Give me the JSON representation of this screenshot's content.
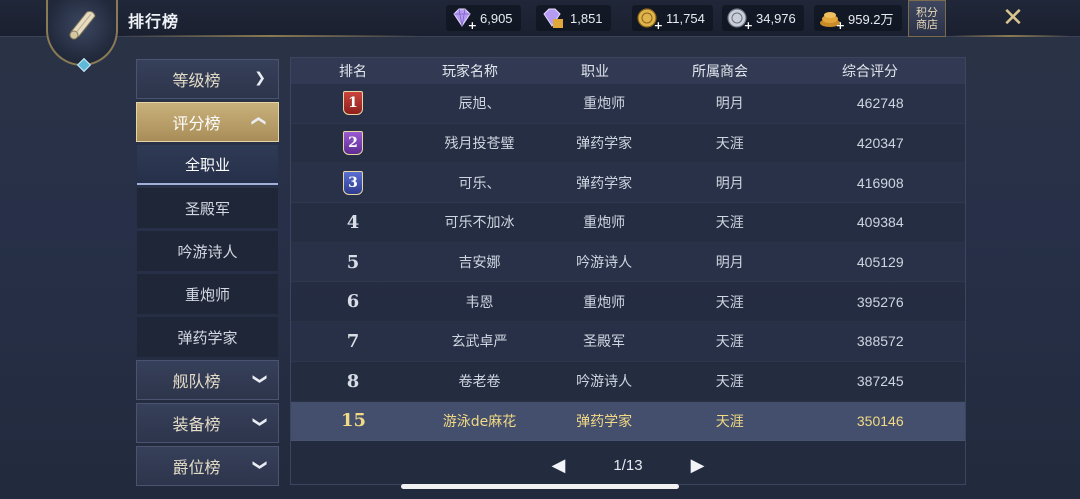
{
  "header": {
    "title": "排行榜",
    "shop_label": "积分商店",
    "currencies": [
      {
        "icon": "diamond-plus-icon",
        "value": "6,905",
        "color": "#b59cf2"
      },
      {
        "icon": "diamond-bound-icon",
        "value": "1,851",
        "color": "#b59cf2"
      },
      {
        "icon": "gold-coin-icon",
        "value": "11,754",
        "color": "#e0b44c"
      },
      {
        "icon": "silver-coin-icon",
        "value": "34,976",
        "color": "#c9ced8"
      },
      {
        "icon": "gold-pile-icon",
        "value": "959.2万",
        "color": "#e3a63c"
      }
    ]
  },
  "sidebar": {
    "categories": [
      {
        "label": "等级榜",
        "expanded": false
      },
      {
        "label": "评分榜",
        "expanded": true
      },
      {
        "label": "舰队榜",
        "expanded": false
      },
      {
        "label": "装备榜",
        "expanded": false
      },
      {
        "label": "爵位榜",
        "expanded": false
      }
    ],
    "sub_items": [
      "全职业",
      "圣殿军",
      "吟游诗人",
      "重炮师",
      "弹药学家"
    ],
    "active_sub": "全职业"
  },
  "table": {
    "headers": [
      "排名",
      "玩家名称",
      "职业",
      "所属商会",
      "综合评分"
    ],
    "rows": [
      {
        "rank": "1",
        "name": "辰旭、",
        "job": "重炮师",
        "guild": "明月",
        "score": "462748"
      },
      {
        "rank": "2",
        "name": "残月投苍璧",
        "job": "弹药学家",
        "guild": "天涯",
        "score": "420347"
      },
      {
        "rank": "3",
        "name": "可乐、",
        "job": "弹药学家",
        "guild": "明月",
        "score": "416908"
      },
      {
        "rank": "4",
        "name": "可乐不加冰",
        "job": "重炮师",
        "guild": "天涯",
        "score": "409384"
      },
      {
        "rank": "5",
        "name": "吉安娜",
        "job": "吟游诗人",
        "guild": "明月",
        "score": "405129"
      },
      {
        "rank": "6",
        "name": "韦恩",
        "job": "重炮师",
        "guild": "天涯",
        "score": "395276"
      },
      {
        "rank": "7",
        "name": "玄武卓严",
        "job": "圣殿军",
        "guild": "天涯",
        "score": "388572"
      },
      {
        "rank": "8",
        "name": "卷老卷",
        "job": "吟游诗人",
        "guild": "天涯",
        "score": "387245"
      }
    ],
    "self_row": {
      "rank": "15",
      "name": "游泳de麻花",
      "job": "弹药学家",
      "guild": "天涯",
      "score": "350146"
    },
    "pagination": {
      "text": "1/13",
      "prev": "◀",
      "next": "▶"
    }
  },
  "colors": {
    "accent_gold": "#f1d985",
    "active_tab": "#c9b17c"
  }
}
